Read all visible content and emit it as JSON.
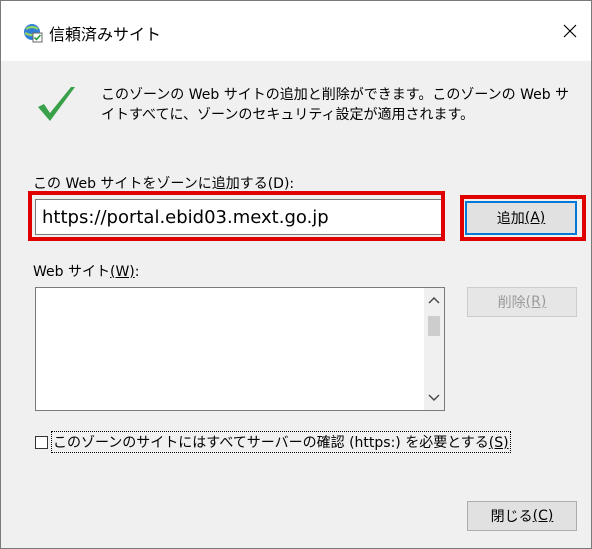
{
  "window": {
    "title": "信頼済みサイト",
    "title_icon": "globe-check-icon",
    "close_icon": "close-icon"
  },
  "description": "このゾーンの Web サイトの追加と削除ができます。このゾーンの Web サイトすべてに、ゾーンのセキュリティ設定が適用されます。",
  "add_site": {
    "label": "この Web サイトをゾーンに追加する(D):",
    "input_value": "https://portal.ebid03.mext.go.jp",
    "button_text": "追加",
    "button_accel": "(A)"
  },
  "sites": {
    "label_text": "Web サイト",
    "label_accel": "(W)",
    "label_suffix": ":",
    "items": []
  },
  "remove_button": {
    "text": "削除",
    "accel": "(R)"
  },
  "require_https": {
    "checked": false,
    "label_text": "このゾーンのサイトにはすべてサーバーの確認 (https:) を必要とする",
    "label_accel": "(S)"
  },
  "close_button": {
    "text": "閉じる",
    "accel": "(C)"
  },
  "colors": {
    "highlight": "#e00000",
    "focus_border": "#0078d7",
    "check_green": "#3aa14a"
  }
}
